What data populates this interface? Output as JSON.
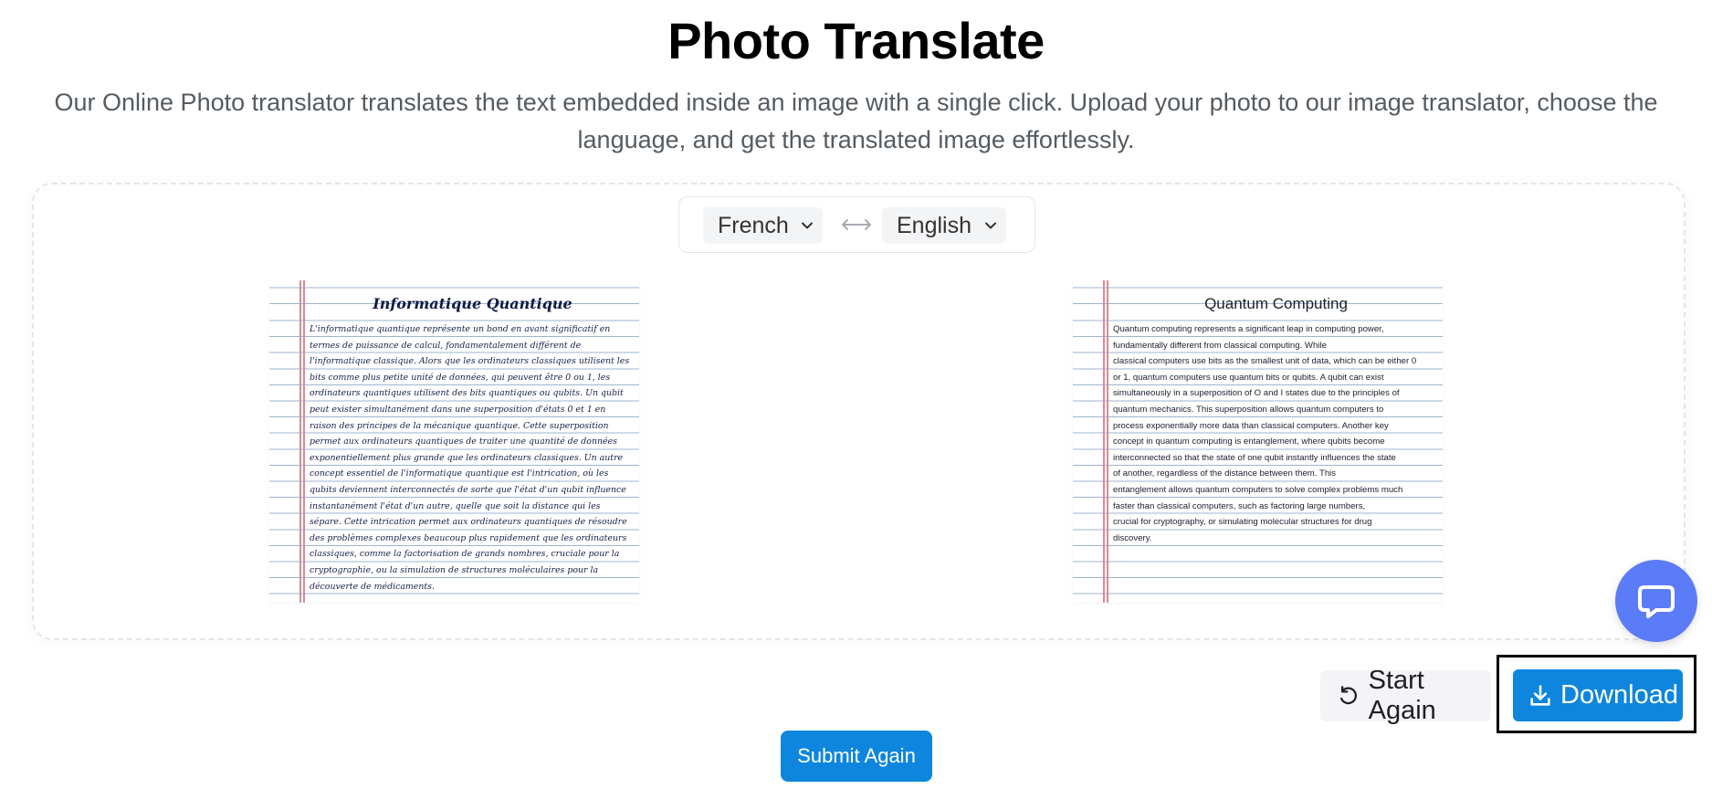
{
  "header": {
    "title": "Photo Translate",
    "subtitle": "Our Online Photo translator translates the text embedded inside an image with a single click. Upload your photo to our image translator, choose the language, and get the translated image effortlessly."
  },
  "languages": {
    "source": "French",
    "target": "English"
  },
  "original_image": {
    "title": "Informatique Quantique",
    "lines": [
      "L'informatique quantique représente un bond en avant significatif en",
      "termes de puissance de calcul, fondamentalement différent de",
      "l'informatique classique. Alors que les ordinateurs classiques utilisent les",
      "bits comme plus petite unité de données, qui peuvent être 0 ou 1, les",
      "ordinateurs quantiques utilisent des bits quantiques ou qubits. Un qubit",
      "peut exister simultanément dans une superposition d'états 0 et 1 en",
      "raison des principes de la mécanique quantique. Cette superposition",
      "permet aux ordinateurs quantiques de traiter une quantité de données",
      "exponentiellement plus grande que les ordinateurs classiques. Un autre",
      "concept essentiel de l'informatique quantique est l'intrication, où les",
      "qubits deviennent interconnectés de sorte que l'état d'un qubit influence",
      "instantanément l'état d'un autre, quelle que soit la distance qui les",
      "sépare. Cette intrication permet aux ordinateurs quantiques de résoudre",
      "des problèmes complexes beaucoup plus rapidement que les ordinateurs",
      "classiques, comme la factorisation de grands nombres, cruciale pour la",
      "cryptographie, ou la simulation de structures moléculaires pour la",
      "découverte de médicaments."
    ]
  },
  "translated_image": {
    "title": "Quantum Computing",
    "lines": [
      "Quantum computing represents a significant leap in computing power,",
      "fundamentally different from classical computing. While",
      "classical computers use bits as the smallest unit of data, which can be either 0",
      "or 1, quantum computers use quantum bits or qubits. A qubit can exist",
      "simultaneously in a superposition of O and I states due to the principles of",
      "quantum mechanics. This superposition allows quantum computers to",
      "process exponentially more data than classical computers. Another key",
      "concept in quantum computing is entanglement, where qubits become",
      "interconnected so that the state of one qubit instantly influences the state",
      "of another, regardless of the distance between them. This",
      "entanglement allows quantum computers to solve complex problems much",
      "faster than classical computers, such as factoring large numbers,",
      "crucial for cryptography, or simulating molecular structures for drug",
      "discovery."
    ]
  },
  "actions": {
    "start_again": "Start Again",
    "download": "Download",
    "submit_again": "Submit Again"
  },
  "icons": {
    "chevron": "chevron-down-icon",
    "swap": "swap-arrows-icon",
    "refresh": "refresh-icon",
    "download": "download-icon",
    "chat": "chat-icon"
  },
  "colors": {
    "primary": "#0e86de",
    "chat": "#5b7cf8"
  }
}
